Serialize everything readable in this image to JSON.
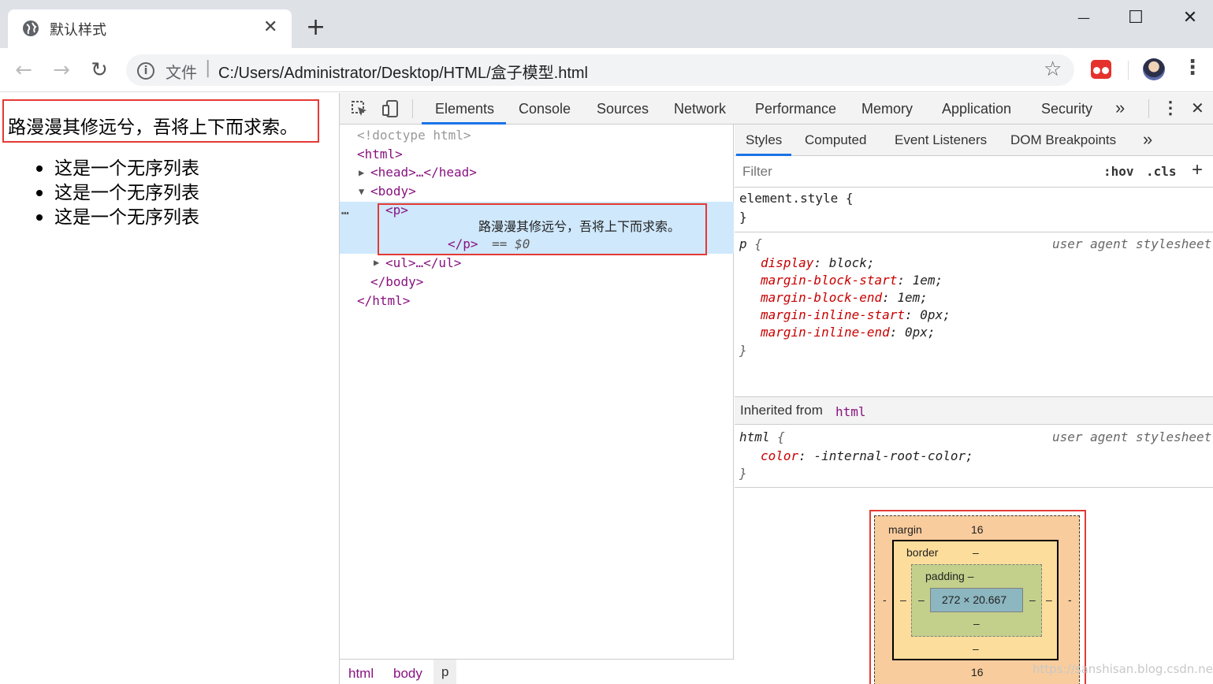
{
  "browser": {
    "tab_title": "默认样式",
    "tab_close": "✕",
    "new_tab": "+",
    "window_controls": {
      "minimize": "—",
      "maximize": "☐",
      "close": "✕"
    },
    "nav": {
      "back": "←",
      "forward": "→",
      "reload": "↻"
    },
    "omnibox": {
      "info": "i",
      "file_label": "文件",
      "separator": "|",
      "url": "C:/Users/Administrator/Desktop/HTML/盒子模型.html",
      "star": "☆"
    },
    "menu": "⋮"
  },
  "page": {
    "paragraph": "路漫漫其修远兮，吾将上下而求索。",
    "list_items": [
      "这是一个无序列表",
      "这是一个无序列表",
      "这是一个无序列表"
    ]
  },
  "devtools": {
    "tabs": [
      "Elements",
      "Console",
      "Sources",
      "Network",
      "Performance",
      "Memory",
      "Application",
      "Security"
    ],
    "active_tab": "Elements",
    "more_tabs": "»",
    "kebab": "⋮",
    "close": "✕",
    "dom": {
      "doctype": "<!doctype html>",
      "html_open": "<html>",
      "head": "<head>…</head>",
      "body_open": "<body>",
      "p_open": "<p>",
      "p_text": "路漫漫其修远兮，吾将上下而求索。",
      "p_close": "</p>",
      "sel_marker": "== $0",
      "ellipsis": "…",
      "ul": "<ul>…</ul>",
      "body_close": "</body>",
      "html_close": "</html>"
    },
    "breadcrumb": [
      "html",
      "body",
      "p"
    ],
    "styles": {
      "tabs": [
        "Styles",
        "Computed",
        "Event Listeners",
        "DOM Breakpoints"
      ],
      "more": "»",
      "filter_placeholder": "Filter",
      "hov": ":hov",
      "cls": ".cls",
      "plus": "+",
      "element_style_open": "element.style {",
      "close_brace": "}",
      "p_selector": "p",
      "open_brace": "{",
      "ua_label": "user agent stylesheet",
      "p_props": [
        {
          "name": "display",
          "value": "block;"
        },
        {
          "name": "margin-block-start",
          "value": "1em;"
        },
        {
          "name": "margin-block-end",
          "value": "1em;"
        },
        {
          "name": "margin-inline-start",
          "value": "0px;"
        },
        {
          "name": "margin-inline-end",
          "value": "0px;"
        }
      ],
      "inherited_label": "Inherited from",
      "inherited_from": "html",
      "html_selector": "html",
      "html_props": [
        {
          "name": "color",
          "value": "-internal-root-color;"
        }
      ]
    },
    "box_model": {
      "margin_label": "margin",
      "margin_top": "16",
      "margin_bottom": "16",
      "margin_left": "-",
      "margin_right": "-",
      "border_label": "border",
      "border_top": "–",
      "border_bottom": "–",
      "border_left": "–",
      "border_right": "–",
      "padding_label": "padding –",
      "padding_bottom": "–",
      "padding_left": "–",
      "padding_right": "–",
      "content": "272 × 20.667"
    }
  },
  "watermark": "https://sanshisan.blog.csdn.net"
}
